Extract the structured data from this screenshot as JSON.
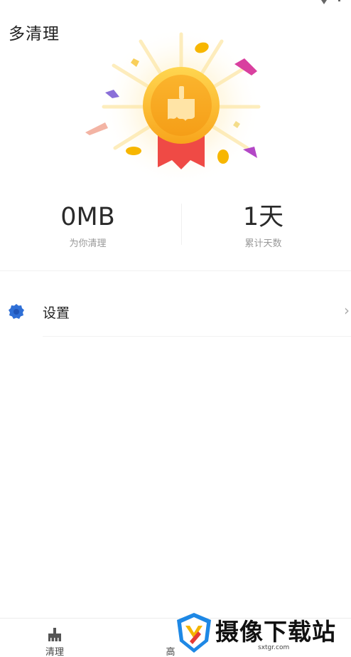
{
  "header": {
    "title": "多清理"
  },
  "stats": {
    "cleaned_value": "0MB",
    "cleaned_label": "为你清理",
    "days_value": "1天",
    "days_label": "累计天数"
  },
  "menu": [
    {
      "label": "设置",
      "icon": "gear-icon",
      "chevron": "›"
    }
  ],
  "bottom_nav": [
    {
      "label": "清理",
      "icon": "broom-icon"
    },
    {
      "label": "高"
    }
  ],
  "watermark": {
    "title": "摄像下载站",
    "url": "sxtgr.com"
  },
  "colors": {
    "medal_gold": "#fbb829",
    "ribbon_red": "#ef4a45",
    "settings_blue": "#2f6fd6",
    "text": "#222222",
    "muted": "#999999"
  }
}
